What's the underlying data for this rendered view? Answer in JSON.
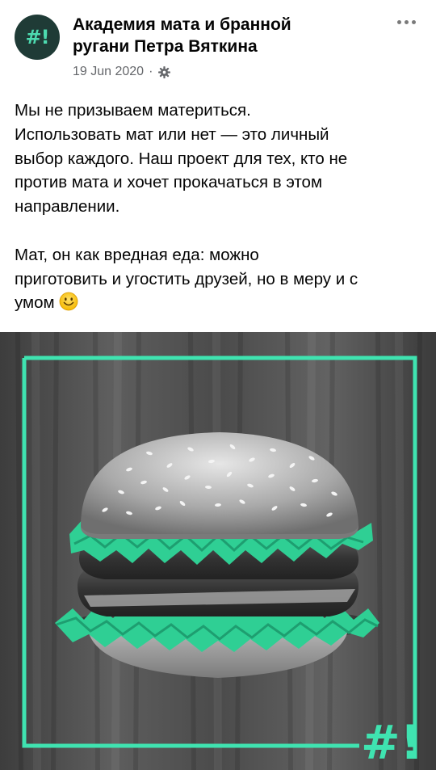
{
  "post": {
    "avatar_text": "#!",
    "page_name": "Академия мата и бранной ругани Петра Вяткина",
    "date": "19 Jun 2020",
    "separator": "·",
    "privacy_icon": "gear-icon",
    "more_icon": "more-dots-icon",
    "paragraph1": "Мы не призываем материться.\nИспользовать мат или нет — это личный\nвыбор каждого. Наш проект для тех, кто не\nпротив мата и хочет прокачаться в этом\nнаправлении.",
    "paragraph2": "Мат, он как вредная еда: можно\nприготовить и угостить друзей, но в меру и с\nумом ",
    "emoji": "smiling-face-emoji"
  },
  "image": {
    "subject": "burger-illustration",
    "frame_mark": "#!",
    "colors": {
      "accent": "#3fe3b0",
      "lettuce": "#2fcf94",
      "background": "#4a4a4a"
    }
  }
}
